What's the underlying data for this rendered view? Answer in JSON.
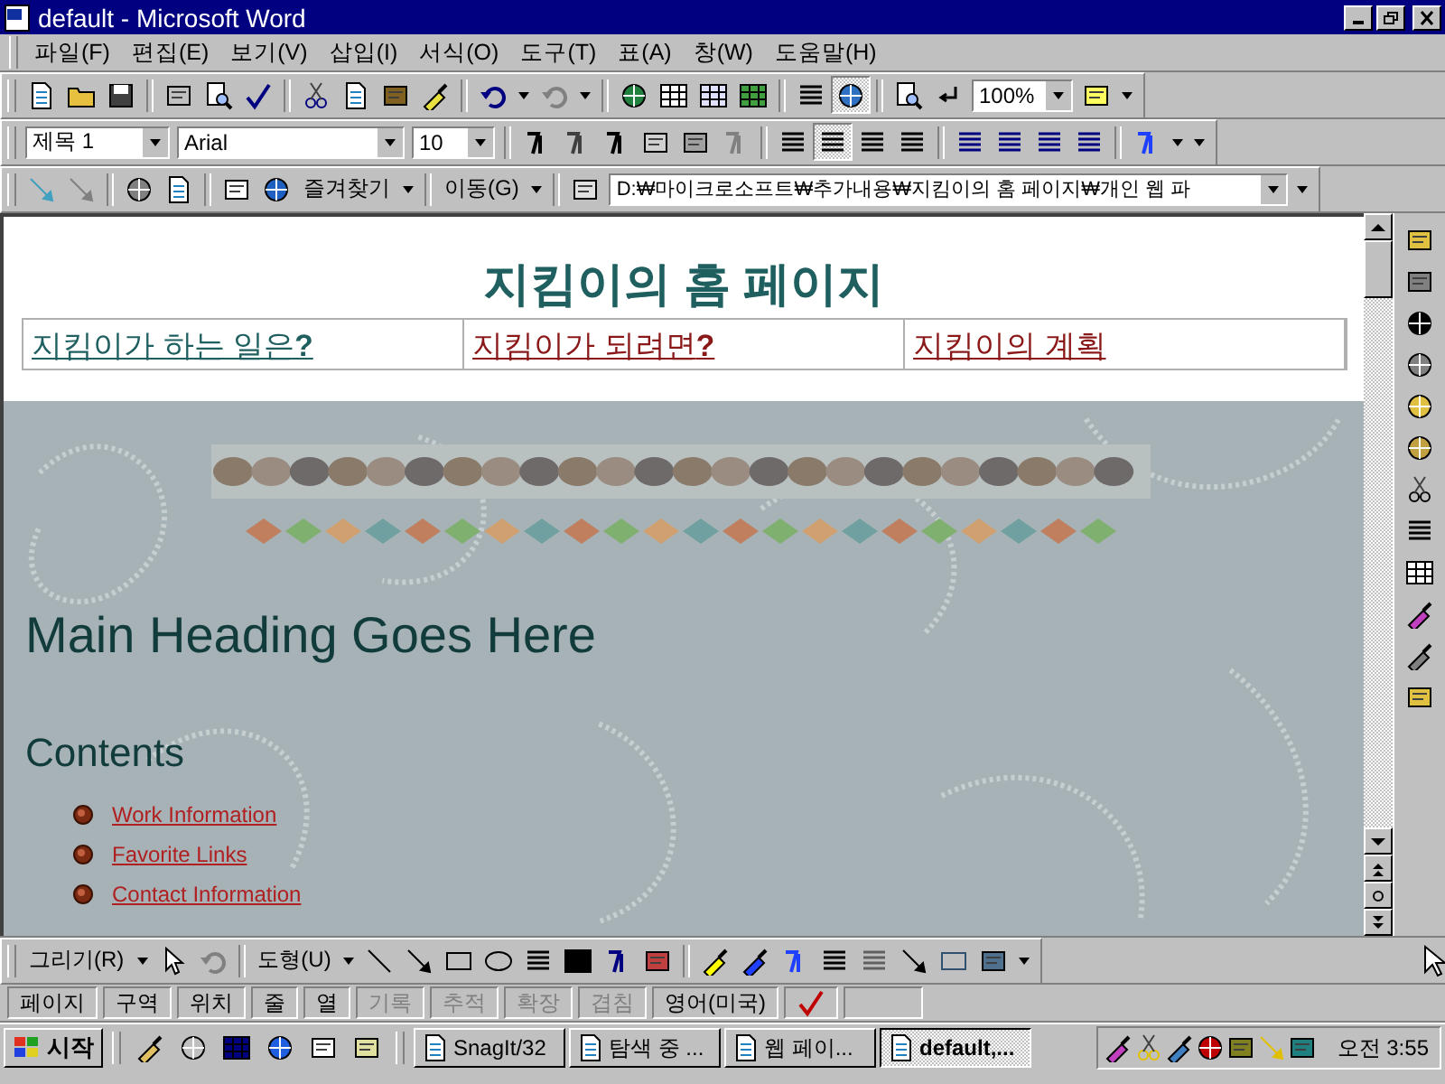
{
  "window": {
    "title": "default - Microsoft Word"
  },
  "menu": [
    "파일(F)",
    "편집(E)",
    "보기(V)",
    "삽입(I)",
    "서식(O)",
    "도구(T)",
    "표(A)",
    "창(W)",
    "도움말(H)"
  ],
  "standard_toolbar": {
    "zoom": "100%",
    "web_toolbar_shown": true
  },
  "formatting_toolbar": {
    "style": "제목 1",
    "font": "Arial",
    "size": "10",
    "align_buttons": [
      {
        "pressed": false
      },
      {
        "pressed": true
      },
      {
        "pressed": false
      },
      {
        "pressed": false
      }
    ]
  },
  "web_toolbar": {
    "favorites": "즐겨찾기",
    "go": "이동(G)",
    "address": "D:₩마이크로소프트₩추가내용₩지킴이의 홈 페이지₩개인 웹 파"
  },
  "document": {
    "title": "지킴이의 홈 페이지",
    "nav_links": [
      {
        "text": "지킴이가 하는 일은**?**",
        "visited": true
      },
      {
        "text": "지킴이가 되려면**?**",
        "visited": false
      },
      {
        "text": "지킴이의 계획",
        "visited": false
      }
    ],
    "main_heading": "Main Heading Goes Here",
    "contents_heading": "Contents",
    "contents_links": [
      "Work Information",
      "Favorite Links",
      "Contact Information"
    ]
  },
  "drawing_toolbar": {
    "draw_menu": "그리기(R)",
    "autoshapes_menu": "도형(U)"
  },
  "status_bar": [
    {
      "text": "페이지",
      "disabled": false
    },
    {
      "text": "구역",
      "disabled": false
    },
    {
      "text": "위치",
      "disabled": false
    },
    {
      "text": "줄",
      "disabled": false
    },
    {
      "text": "열",
      "disabled": false
    },
    {
      "text": "기록",
      "disabled": true
    },
    {
      "text": "추적",
      "disabled": true
    },
    {
      "text": "확장",
      "disabled": true
    },
    {
      "text": "겹침",
      "disabled": true
    },
    {
      "text": "영어(미국)",
      "disabled": false
    }
  ],
  "taskbar": {
    "start": "시작",
    "tasks": [
      {
        "label": "SnagIt/32",
        "selected": false
      },
      {
        "label": "탐색 중 ...",
        "selected": false
      },
      {
        "label": "웹 페이...",
        "selected": false
      },
      {
        "label": "default,...",
        "selected": true
      }
    ],
    "clock": "오전 3:55"
  }
}
